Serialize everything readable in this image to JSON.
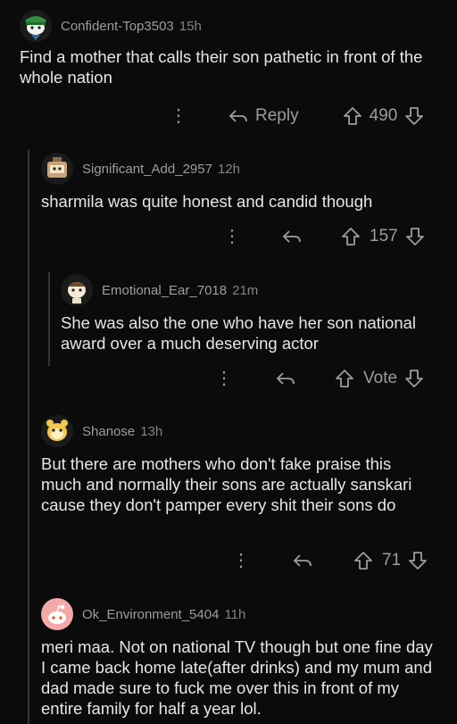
{
  "comments": [
    {
      "user": "Confident-Top3503",
      "time": "15h",
      "body": "Find a mother that calls their son pathetic in front of the whole nation",
      "reply_label": "Reply",
      "score": "490"
    },
    {
      "user": "Significant_Add_2957",
      "time": "12h",
      "body": "sharmila was quite honest and candid though",
      "score": "157"
    },
    {
      "user": "Emotional_Ear_7018",
      "time": "21m",
      "body": "She was also the one who have her son national award over a much deserving actor",
      "score": "Vote"
    },
    {
      "user": "Shanose",
      "time": "13h",
      "body": "But there are mothers who don't fake praise this much and normally their sons are actually sanskari cause they don't pamper every shit their sons do",
      "score": "71"
    },
    {
      "user": "Ok_Environment_5404",
      "time": "11h",
      "body": "meri maa. Not on national TV though but one fine day I came back home late(after drinks) and my mum and dad made sure to fuck me over this in front of my entire family for half a year lol."
    }
  ],
  "icons": {
    "more": "more-options-icon",
    "reply": "reply-arrow-icon",
    "upvote": "upvote-arrow-icon",
    "downvote": "downvote-arrow-icon"
  },
  "colors": {
    "background": "#0b0b0b",
    "text": "#e4e6e8",
    "meta": "#9a9da0",
    "thread_line": "#343536"
  }
}
